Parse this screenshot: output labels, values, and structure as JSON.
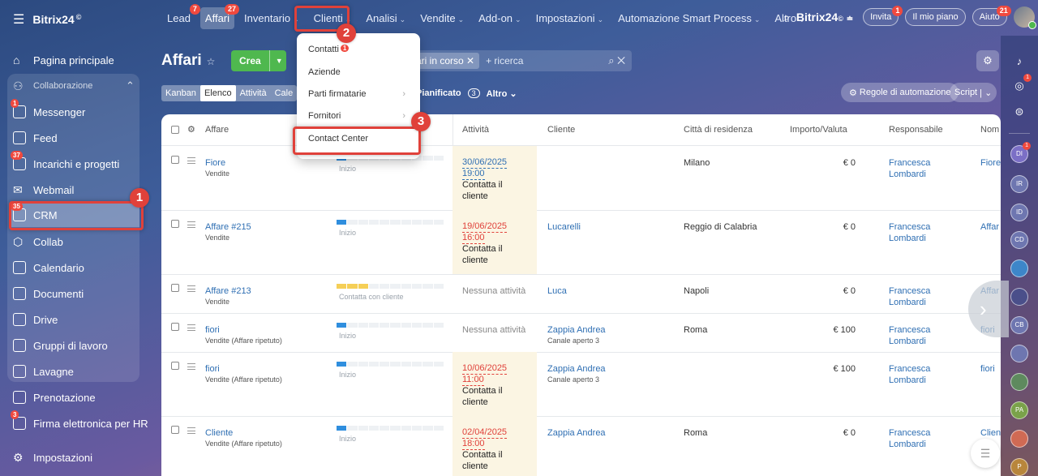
{
  "app": {
    "logo": "Bitrix24",
    "logo_mark": "©"
  },
  "topnav": {
    "tabs": [
      {
        "label": "Lead",
        "badge": "7",
        "chevron": false
      },
      {
        "label": "Affari",
        "badge": "27",
        "chevron": false,
        "active": true
      },
      {
        "label": "Inventario",
        "chevron": true
      },
      {
        "label": "Clienti",
        "chevron": true,
        "highlight": true
      },
      {
        "label": "Analisi",
        "chevron": true
      },
      {
        "label": "Vendite",
        "chevron": true
      },
      {
        "label": "Add-on",
        "chevron": true
      },
      {
        "label": "Impostazioni",
        "chevron": true
      },
      {
        "label": "Automazione Smart Process",
        "chevron": true
      },
      {
        "label": "Altro",
        "chevron": true
      }
    ],
    "right": {
      "brand": "Bitrix24",
      "invite": "Invita",
      "invite_badge": "1",
      "plan": "Il mio piano",
      "help": "Aiuto",
      "help_badge": "21"
    }
  },
  "sidebar": {
    "items": [
      {
        "label": "Pagina principale",
        "icon": "home-icon"
      },
      {
        "label": "Collaborazione",
        "icon": "collab-icon",
        "section": true
      },
      {
        "label": "Messenger",
        "icon": "chat-icon",
        "badge": "1"
      },
      {
        "label": "Feed",
        "icon": "feed-icon"
      },
      {
        "label": "Incarichi e progetti",
        "icon": "tasks-icon",
        "badge": "37"
      },
      {
        "label": "Webmail",
        "icon": "mail-icon"
      },
      {
        "label": "CRM",
        "icon": "crm-icon",
        "badge": "35"
      },
      {
        "label": "Collab",
        "icon": "collab-hex-icon"
      },
      {
        "label": "Calendario",
        "icon": "calendar-icon"
      },
      {
        "label": "Documenti",
        "icon": "documents-icon"
      },
      {
        "label": "Drive",
        "icon": "drive-icon"
      },
      {
        "label": "Gruppi di lavoro",
        "icon": "groups-icon"
      },
      {
        "label": "Lavagne",
        "icon": "board-icon"
      },
      {
        "label": "Prenotazione",
        "icon": "booking-icon"
      },
      {
        "label": "Firma elettronica per HR",
        "icon": "sign-icon",
        "badge": "3"
      },
      {
        "label": "Impostazioni",
        "icon": "settings-icon"
      }
    ]
  },
  "page": {
    "title": "Affari",
    "create": "Crea",
    "filter_chip": "ari in corso",
    "search_placeholder": "+ ricerca",
    "view_tabs": [
      "Kanban",
      "Elenco",
      "Attività",
      "Cale"
    ],
    "planned": "Pianificato",
    "planned_count": "3",
    "more": "Altro",
    "automation": "Regole di automazione",
    "script": "Script"
  },
  "dropdown": {
    "items": [
      {
        "label": "Contatti",
        "badge": "1",
        "arrow": false
      },
      {
        "label": "Aziende",
        "arrow": false
      },
      {
        "label": "Parti firmatarie",
        "arrow": true
      },
      {
        "label": "Fornitori",
        "arrow": true
      },
      {
        "label": "Contact Center",
        "arrow": false
      }
    ]
  },
  "callouts": [
    "1",
    "2",
    "3"
  ],
  "table": {
    "columns": [
      "Affare",
      "Attività",
      "Cliente",
      "Città di residenza",
      "Importo/Valuta",
      "Responsabile",
      "Nom"
    ],
    "rows": [
      {
        "name": "Fiore",
        "pipeline": "Vendite",
        "stage": "Inizio",
        "bar": "blue1",
        "date": "30/06/2025",
        "time": "19:00",
        "activity": "Contatta il cliente",
        "overdue": false,
        "client": "",
        "client_sub": "",
        "city": "Milano",
        "amount": "0 €",
        "resp1": "Francesca",
        "resp2": "Lombardi",
        "nom": "Fiore"
      },
      {
        "name": "Affare #215",
        "pipeline": "Vendite",
        "stage": "Inizio",
        "bar": "blue1",
        "date": "19/06/2025",
        "time": "16:00",
        "activity": "Contatta il cliente",
        "overdue": true,
        "client": "Lucarelli",
        "client_sub": "",
        "city": "Reggio di Calabria",
        "amount": "0 €",
        "resp1": "Francesca",
        "resp2": "Lombardi",
        "nom": "Affar"
      },
      {
        "name": "Affare #213",
        "pipeline": "Vendite",
        "stage": "Contatta con cliente",
        "bar": "yellow3",
        "date": "",
        "time": "",
        "activity": "Nessuna attività",
        "overdue": false,
        "client": "Luca",
        "client_sub": "",
        "city": "Napoli",
        "amount": "0 €",
        "resp1": "Francesca",
        "resp2": "Lombardi",
        "nom": "Affar"
      },
      {
        "name": "fiori",
        "pipeline": "Vendite (Affare ripetuto)",
        "stage": "Inizio",
        "bar": "blue1",
        "date": "",
        "time": "",
        "activity": "Nessuna attività",
        "overdue": false,
        "client": "Zappia Andrea",
        "client_sub": "Canale aperto 3",
        "city": "Roma",
        "amount": "100 €",
        "resp1": "Francesca",
        "resp2": "Lombardi",
        "nom": "fiori"
      },
      {
        "name": "fiori",
        "pipeline": "Vendite (Affare ripetuto)",
        "stage": "Inizio",
        "bar": "blue1",
        "date": "10/06/2025",
        "time": "11:00",
        "activity": "Contatta il cliente",
        "overdue": true,
        "client": "Zappia Andrea",
        "client_sub": "Canale aperto 3",
        "city": "",
        "amount": "100 €",
        "resp1": "Francesca",
        "resp2": "Lombardi",
        "nom": "fiori"
      },
      {
        "name": "Cliente",
        "pipeline": "Vendite (Affare ripetuto)",
        "stage": "Inizio",
        "bar": "blue1",
        "date": "02/04/2025",
        "time": "18:00",
        "activity": "Contatta il cliente",
        "overdue": true,
        "client": "Zappia Andrea",
        "client_sub": "",
        "city": "Roma",
        "amount": "0 €",
        "resp1": "Francesca",
        "resp2": "Lombardi",
        "nom": "Clien"
      }
    ]
  },
  "right_panel": {
    "avatars": [
      "DI",
      "IR",
      "ID",
      "CD",
      "CB",
      "PA",
      "P"
    ]
  },
  "colors": {
    "accent": "#2f6fb3",
    "highlight": "#e0413a",
    "create": "#4fb84f",
    "badge": "#f0493e"
  }
}
